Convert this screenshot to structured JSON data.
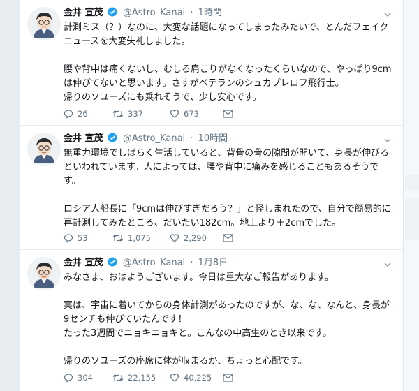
{
  "tweets": [
    {
      "name": "金井 宣茂",
      "handle": "@Astro_Kanai",
      "time": "1時間",
      "lines": [
        "計測ミス（？）なのに、大変な話題になってしまったみたいで、とんだフェイク",
        "ニュースを大変失礼しました。",
        "",
        "腰や背中は痛くないし、むしろ肩こりがなくなったくらいなので、やっぱり9cm",
        "は伸びてないと思います。さすがベテランのシュカプレロフ飛行士。",
        "帰りのソユーズにも乗れそうで、少し安心です。"
      ],
      "replies": "26",
      "retweets": "337",
      "likes": "673"
    },
    {
      "name": "金井 宣茂",
      "handle": "@Astro_Kanai",
      "time": "10時間",
      "lines": [
        "無重力環境でしばらく生活していると、背骨の骨の隙間が開いて、身長が伸びる",
        "といわれています。人によっては、腰や背中に痛みを感じることもあるそうで",
        "す。",
        "",
        "ロシア人船長に「9cmは伸びすぎだろう？」と怪しまれたので、自分で簡易的に",
        "再計測してみたところ、だいたい182cm。地上より＋2cmでした。"
      ],
      "replies": "53",
      "retweets": "1,075",
      "likes": "2,290"
    },
    {
      "name": "金井 宣茂",
      "handle": "@Astro_Kanai",
      "time": "1月8日",
      "lines": [
        "みなさま、おはようございます。今日は重大なご報告があります。",
        "",
        "実は、宇宙に着いてからの身体計測があったのですが、な、な、なんと、身長が",
        "9センチも伸びていたんです！",
        "たった3週間でニョキニョキと。こんなの中高生のとき以来です。",
        "",
        "帰りのソユーズの座席に体が収まるか、ちょっと心配です。"
      ],
      "replies": "304",
      "retweets": "22,155",
      "likes": "40,225"
    }
  ],
  "icons": {
    "verified": "verified-badge-icon",
    "caret": "chevron-down-icon",
    "reply": "reply-icon",
    "retweet": "retweet-icon",
    "like": "heart-icon",
    "dm": "direct-message-icon"
  },
  "colors": {
    "verified": "#1da1f2",
    "meta": "#657786",
    "text": "#14171a",
    "background": "#e6ecf0"
  }
}
